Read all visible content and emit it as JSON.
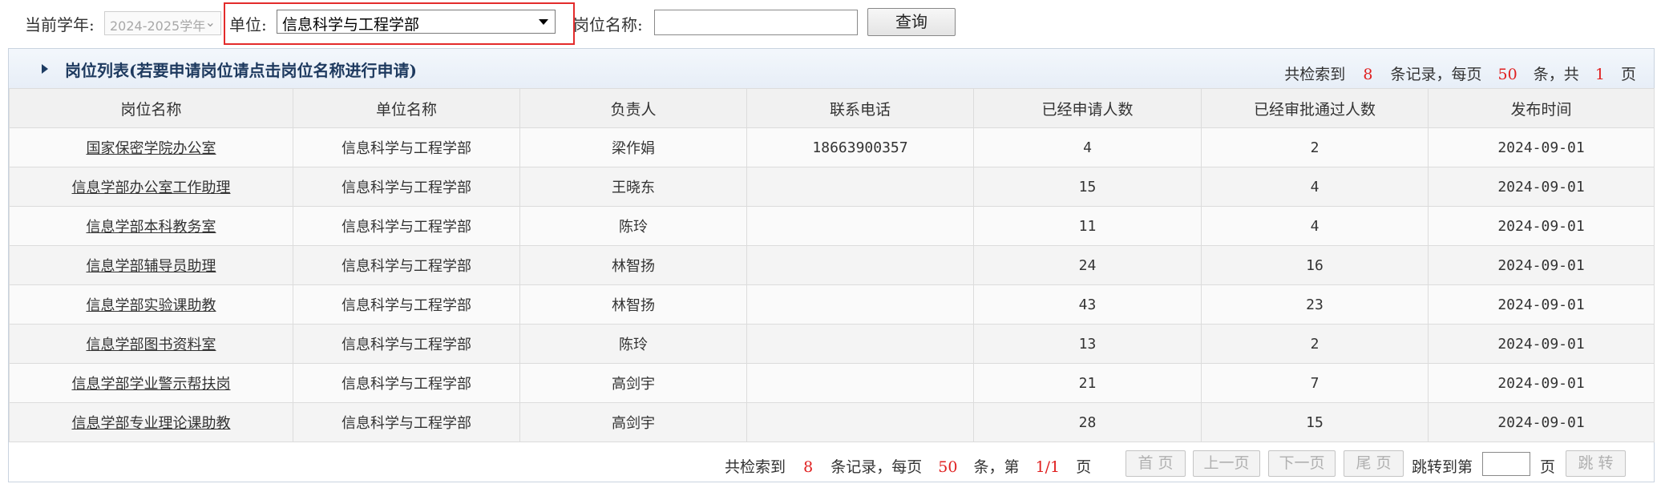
{
  "filters": {
    "year_label": "当前学年:",
    "year_value": "2024-2025学年",
    "unit_label": "单位:",
    "unit_value": "信息科学与工程学部",
    "position_label": "岗位名称:",
    "position_value": "",
    "query_button": "查询"
  },
  "panel": {
    "title": "岗位列表(若要申请岗位请点击岗位名称进行申请)",
    "stats_prefix": "共检索到",
    "stats_records": "8",
    "stats_mid": "条记录，每页",
    "stats_per_page": "50",
    "stats_mid2": "条，共",
    "stats_pages": "1",
    "stats_suffix": "页"
  },
  "table": {
    "columns": [
      "岗位名称",
      "单位名称",
      "负责人",
      "联系电话",
      "已经申请人数",
      "已经审批通过人数",
      "发布时间"
    ],
    "rows": [
      [
        "国家保密学院办公室",
        "信息科学与工程学部",
        "梁作娟",
        "18663900357",
        "4",
        "2",
        "2024-09-01"
      ],
      [
        "信息学部办公室工作助理",
        "信息科学与工程学部",
        "王晓东",
        "",
        "15",
        "4",
        "2024-09-01"
      ],
      [
        "信息学部本科教务室",
        "信息科学与工程学部",
        "陈玲",
        "",
        "11",
        "4",
        "2024-09-01"
      ],
      [
        "信息学部辅导员助理",
        "信息科学与工程学部",
        "林智扬",
        "",
        "24",
        "16",
        "2024-09-01"
      ],
      [
        "信息学部实验课助教",
        "信息科学与工程学部",
        "林智扬",
        "",
        "43",
        "23",
        "2024-09-01"
      ],
      [
        "信息学部图书资料室",
        "信息科学与工程学部",
        "陈玲",
        "",
        "13",
        "2",
        "2024-09-01"
      ],
      [
        "信息学部学业警示帮扶岗",
        "信息科学与工程学部",
        "高剑宇",
        "",
        "21",
        "7",
        "2024-09-01"
      ],
      [
        "信息学部专业理论课助教",
        "信息科学与工程学部",
        "高剑宇",
        "",
        "28",
        "15",
        "2024-09-01"
      ]
    ]
  },
  "pager": {
    "stats_prefix": "共检索到",
    "records": "8",
    "mid": "条记录，每页",
    "per_page": "50",
    "mid2": "条，第",
    "current": "1/1",
    "suffix": "页",
    "first": "首 页",
    "prev": "上一页",
    "next": "下一页",
    "last": "尾 页",
    "jump_label": "跳转到第",
    "jump_suffix": "页",
    "jump_button": "跳 转"
  },
  "colors": {
    "highlight": "#e32b2b",
    "count_red": "#e02020",
    "panel_title": "#1e3a5f"
  },
  "icons": {
    "year_dropdown": "chevron-down-icon",
    "unit_dropdown": "caret-down-icon",
    "panel_toggle": "triangle-right-icon"
  }
}
